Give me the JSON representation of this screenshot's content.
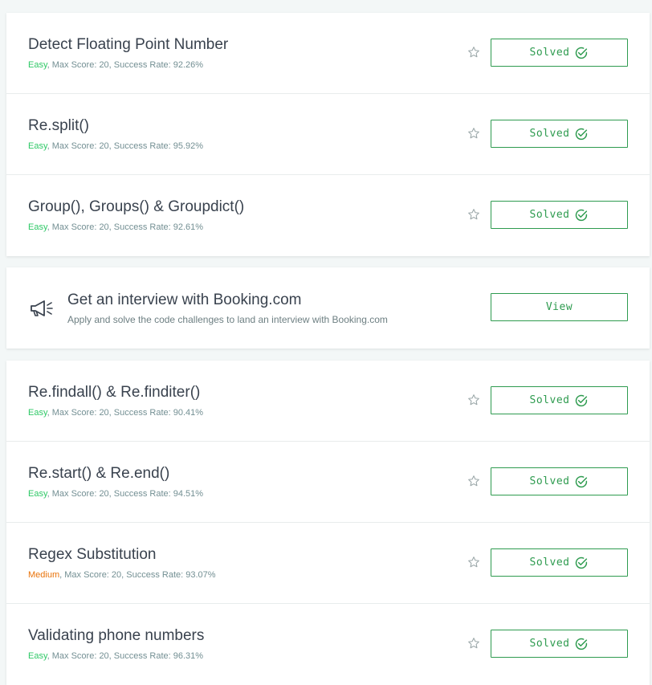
{
  "group1": [
    {
      "title": "Detect Floating Point Number",
      "difficulty": "Easy",
      "stats": ", Max Score: 20, Success Rate: 92.26%",
      "status": "Solved"
    },
    {
      "title": "Re.split()",
      "difficulty": "Easy",
      "stats": ", Max Score: 20, Success Rate: 95.92%",
      "status": "Solved"
    },
    {
      "title": "Group(), Groups() & Groupdict()",
      "difficulty": "Easy",
      "stats": ", Max Score: 20, Success Rate: 92.61%",
      "status": "Solved"
    }
  ],
  "promo": {
    "title": "Get an interview with Booking.com",
    "subtitle": "Apply and solve the code challenges to land an interview with Booking.com",
    "button": "View",
    "icon": "megaphone-icon"
  },
  "group2": [
    {
      "title": "Re.findall() & Re.finditer()",
      "difficulty": "Easy",
      "stats": ", Max Score: 20, Success Rate: 90.41%",
      "status": "Solved"
    },
    {
      "title": "Re.start() & Re.end()",
      "difficulty": "Easy",
      "stats": ", Max Score: 20, Success Rate: 94.51%",
      "status": "Solved"
    },
    {
      "title": "Regex Substitution",
      "difficulty": "Medium",
      "stats": ", Max Score: 20, Success Rate: 93.07%",
      "status": "Solved"
    },
    {
      "title": "Validating phone numbers",
      "difficulty": "Easy",
      "stats": ", Max Score: 20, Success Rate: 96.31%",
      "status": "Solved"
    }
  ],
  "colors": {
    "easy": "#2ec866",
    "medium": "#e9730a",
    "accent": "#2e9b4f"
  },
  "icons": {
    "bookmark": "star-icon",
    "solved": "check-circle-icon"
  }
}
